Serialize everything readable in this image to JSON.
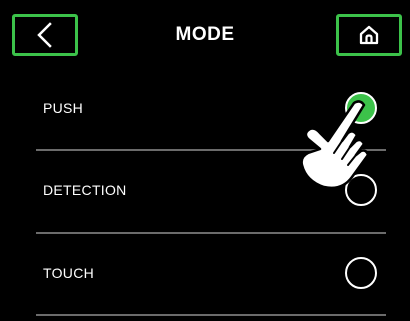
{
  "header": {
    "title": "MODE",
    "back_icon": "chevron-left-icon",
    "home_icon": "home-icon"
  },
  "options": [
    {
      "label": "PUSH",
      "selected": true
    },
    {
      "label": "DETECTION",
      "selected": false
    },
    {
      "label": "TOUCH",
      "selected": false
    }
  ],
  "colors": {
    "background": "#000000",
    "accent": "#3cc24a",
    "text": "#ffffff",
    "divider": "#6b6b6b"
  },
  "pointer_icon": "hand-pointer-icon"
}
